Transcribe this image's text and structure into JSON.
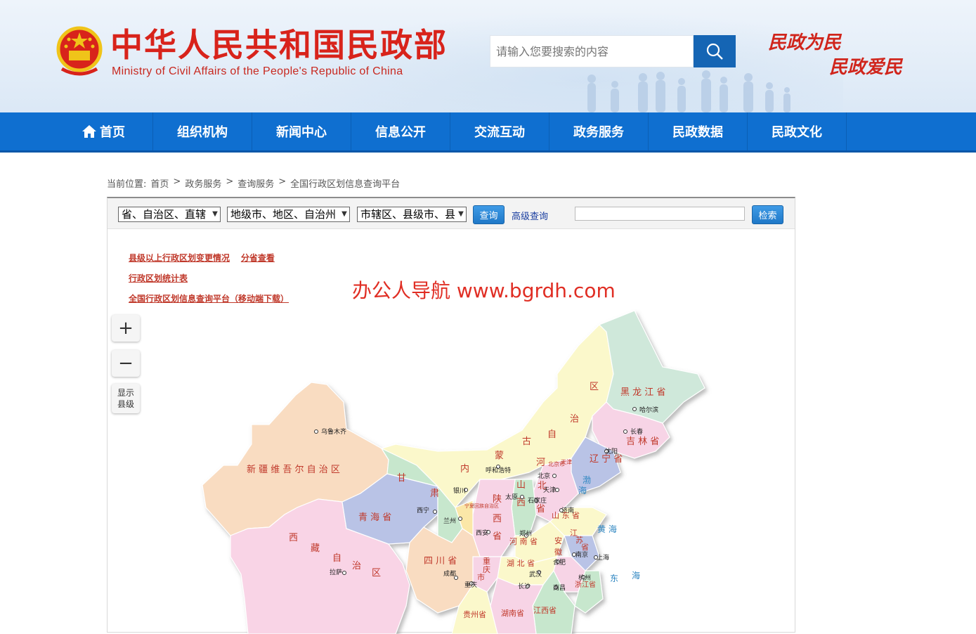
{
  "header": {
    "title": "中华人民共和国民政部",
    "subtitle": "Ministry of Civil Affairs of the People's Republic of China",
    "search_placeholder": "请输入您要搜索的内容",
    "slogan_line1": "民政为民",
    "slogan_line2": "民政爱民"
  },
  "nav": {
    "items": [
      {
        "label": "首页"
      },
      {
        "label": "组织机构"
      },
      {
        "label": "新闻中心"
      },
      {
        "label": "信息公开"
      },
      {
        "label": "交流互动"
      },
      {
        "label": "政务服务"
      },
      {
        "label": "民政数据"
      },
      {
        "label": "民政文化"
      }
    ]
  },
  "breadcrumb": {
    "prefix": "当前位置:",
    "items": [
      "首页",
      "政务服务",
      "查询服务",
      "全国行政区划信息查询平台"
    ],
    "separator": ">"
  },
  "toolbar": {
    "select_province": "省、自治区、直辖",
    "select_city": "地级市、地区、自治州",
    "select_county": "市辖区、县级市、县",
    "query_button": "查询",
    "advanced_link": "高级查询",
    "search_button": "检索",
    "keyword_value": ""
  },
  "links": {
    "change_info": "县级以上行政区划变更情况",
    "by_province": "分省查看",
    "stats_table": "行政区划统计表",
    "mobile_download": "全国行政区划信息查询平台（移动端下载）"
  },
  "watermark": "办公人导航  www.bgrdh.com",
  "map_controls": {
    "zoom_in": "+",
    "zoom_out": "−",
    "show_county_line1": "显示",
    "show_county_line2": "县级"
  },
  "map": {
    "regions": {
      "xinjiang": "新 疆 维 吾 尔 自 治 区",
      "xizang_1": "西",
      "xizang_2": "藏",
      "xizang_3": "自",
      "xizang_4": "治",
      "xizang_5": "区",
      "qinghai": "青  海  省",
      "gansu_1": "甘",
      "gansu_2": "肃",
      "sichuan": "四  川  省",
      "neimenggu_1": "内",
      "neimenggu_2": "蒙",
      "neimenggu_3": "古",
      "neimenggu_4": "自",
      "neimenggu_5": "治",
      "neimenggu_6": "区",
      "heilongjiang": "黑 龙 江 省",
      "jilin": "吉 林 省",
      "liaoning": "辽 宁 省",
      "hebei_1": "河",
      "hebei_2": "北",
      "hebei_3": "省",
      "shanxi_1": "山",
      "shanxi_2": "西",
      "shaanxi_1": "陕",
      "shaanxi_2": "西",
      "shaanxi_3": "省",
      "shandong": "山 东 省",
      "henan": "河 南 省",
      "hubei": "湖 北 省",
      "hunan": "湖南省",
      "jiangxi": "江西省",
      "anhui_1": "安",
      "anhui_2": "徽",
      "jiangsu_1": "江",
      "jiangsu_2": "苏",
      "jiangsu_3": "省",
      "zhejiang": "浙江省",
      "chongqing_1": "重",
      "chongqing_2": "庆",
      "chongqing_3": "市",
      "guizhou": "贵州省",
      "ningxia": "宁夏回族自治区",
      "beijing": "北京市",
      "tianjin": "天津",
      "bohai_1": "渤",
      "bohai_2": "海",
      "huanghai": "黄  海",
      "donghai_1": "东",
      "donghai_2": "海"
    },
    "cities": {
      "urumqi": "乌鲁木齐",
      "lhasa": "拉萨",
      "xining": "西宁",
      "lanzhou": "兰州",
      "yinchuan": "银川",
      "chengdu": "成都",
      "chongqing": "重庆",
      "xian": "西安",
      "hohhot": "呼和浩特",
      "harbin": "哈尔滨",
      "changchun": "长春",
      "shenyang": "沈阳",
      "beijing": "北京",
      "tianjin": "天津",
      "taiyuan": "太原",
      "shijiazhuang": "石家庄",
      "jinan": "济南",
      "zhengzhou": "郑州",
      "wuhan": "武汉",
      "hefei": "合肥",
      "nanjing": "南京",
      "shanghai": "上海",
      "hangzhou": "杭州",
      "changsha": "长沙",
      "nanchang": "南昌"
    }
  },
  "colors": {
    "brand_red": "#d8231b",
    "nav_blue": "#0f6fd0",
    "search_blue": "#1565b4"
  }
}
